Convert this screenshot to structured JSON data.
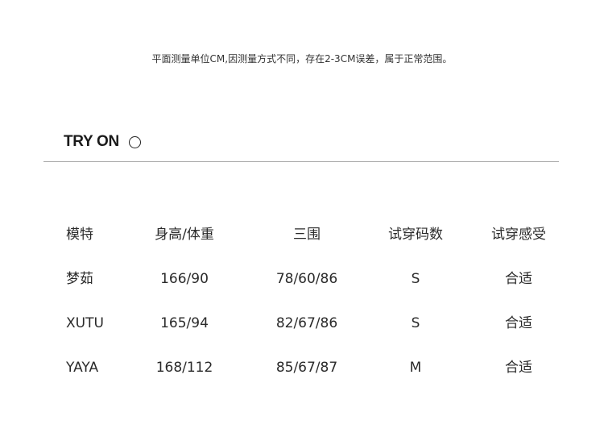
{
  "note": "平面测量单位CM,因测量方式不同，存在2-3CM误差，属于正常范围。",
  "section": {
    "title": "TRY ON",
    "icon": "circle-icon"
  },
  "table": {
    "headers": [
      "模特",
      "身高/体重",
      "三围",
      "试穿码数",
      "试穿感受"
    ],
    "rows": [
      [
        "梦茹",
        "166/90",
        "78/60/86",
        "S",
        "合适"
      ],
      [
        "XUTU",
        "165/94",
        "82/67/86",
        "S",
        "合适"
      ],
      [
        "YAYA",
        "168/112",
        "85/67/87",
        "M",
        "合适"
      ]
    ]
  }
}
